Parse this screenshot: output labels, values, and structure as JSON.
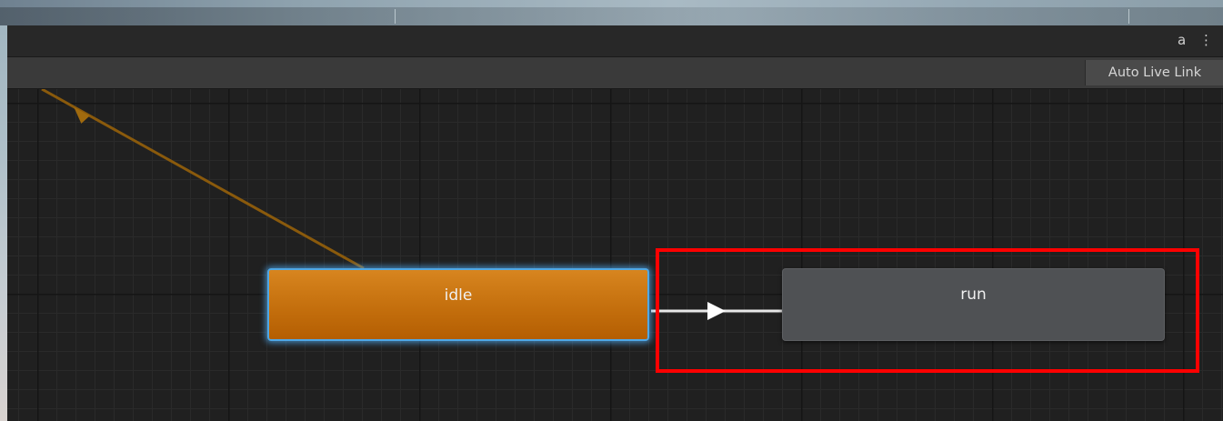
{
  "window": {
    "lock_icon": "lock-icon",
    "menu_icon": "kebab-menu-icon",
    "lock_glyph": "a",
    "menu_glyph": "⋮"
  },
  "toolbar": {
    "auto_live_link_label": "Auto Live Link"
  },
  "graph": {
    "states": [
      {
        "name": "idle",
        "is_default": true
      },
      {
        "name": "run",
        "is_default": false
      }
    ],
    "transitions": [
      {
        "from": "entry",
        "to": "idle"
      },
      {
        "from": "idle",
        "to": "run"
      }
    ]
  },
  "colors": {
    "default_state": "#c46f0d",
    "normal_state": "#4f5154",
    "selection_outline": "#4fa8e6",
    "annotation_box": "#ff0000",
    "entry_transition": "#8a5a0c",
    "transition": "#e8e8e8"
  }
}
